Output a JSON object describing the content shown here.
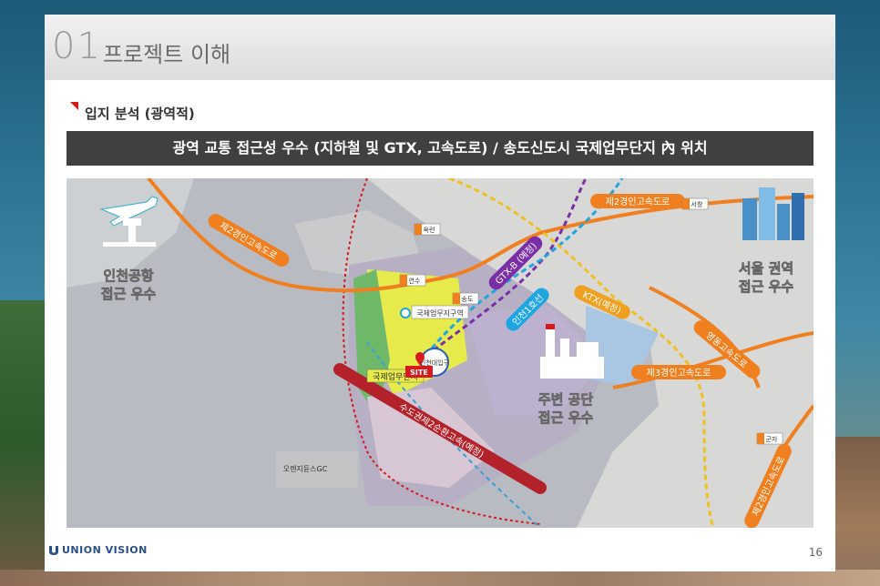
{
  "section": {
    "number": "01",
    "title": "프로젝트 이해"
  },
  "subtitle": "입지 분석 (광역적)",
  "banner": "광역 교통 접근성 우수 (지하철 및 GTX, 고속도로) / 송도신도시 국제업무단지 內 위치",
  "map": {
    "airport": {
      "line1": "인천공항",
      "line2": "접근 우수"
    },
    "seoul": {
      "line1": "서울 권역",
      "line2": "접근 우수"
    },
    "housing": {
      "line1": "주변 공단",
      "line2": "접근 우수"
    },
    "roads": {
      "expressway2_left": "제2경인고속도로",
      "expressway2_top": "제2경인고속도로",
      "expressway3": "제3경인고속도로",
      "yeongdong": "영동고속도로",
      "ring2": "수도권제2순환고속(예정)",
      "east_expressway": "제2경인고속도로"
    },
    "rail": {
      "gtxb": "GTX-B (예정)",
      "line1": "인천1호선",
      "ktx": "KTX(예정)"
    },
    "places": {
      "ibd": "국제업무지구역",
      "ibd_zone": "국제업무단지",
      "univ": "인천대입구",
      "site": "SITE",
      "golf": "오렌지듄스GC"
    },
    "ic": {
      "ic1": "옥련",
      "ic2": "연수",
      "ic3": "송도",
      "ic4": "서창",
      "ic5": "군자"
    }
  },
  "footer": {
    "logo": "UNION VISION",
    "page": "16"
  },
  "colors": {
    "expressway": "#f07f20",
    "gtx": "#7b2fa6",
    "line1": "#1fa5e0",
    "ktx": "#f0a020",
    "ring": "#b3222a",
    "site": "#d71920",
    "banner": "#404040"
  }
}
